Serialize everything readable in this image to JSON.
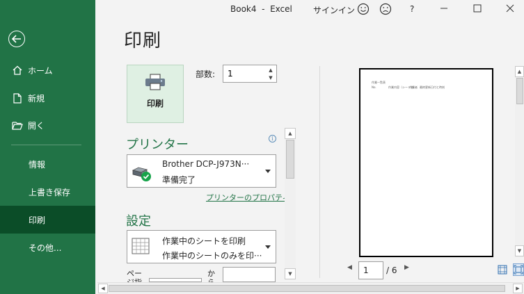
{
  "titlebar": {
    "app_title": "Book4  -  Excel",
    "signin": "サインイン",
    "smile_icon": "smile-icon",
    "frown_icon": "frown-icon",
    "help": "?"
  },
  "sidebar": {
    "back_icon": "back-arrow-icon",
    "items": [
      {
        "label": "ホーム",
        "icon": "home-icon"
      },
      {
        "label": "新規",
        "icon": "new-document-icon"
      },
      {
        "label": "開く",
        "icon": "open-folder-icon"
      },
      {
        "label": "情報"
      },
      {
        "label": "上書き保存"
      },
      {
        "label": "印刷",
        "active": true
      },
      {
        "label": "その他..."
      }
    ]
  },
  "print": {
    "page_title": "印刷",
    "print_button_label": "印刷",
    "copies_label": "部数:",
    "copies_value": "1"
  },
  "printer": {
    "section_title": "プリンター",
    "name": "Brother DCP-J973N···",
    "status": "準備完了",
    "properties_link": "プリンターのプロパティ",
    "info_glyph": "i"
  },
  "settings": {
    "section_title": "設定",
    "scope_line1": "作業中のシートを印刷",
    "scope_line2": "作業中のシートのみを印···",
    "pages_label": "ペー",
    "pages_label_cut": "ジ指",
    "to_label": "か",
    "to_label_cut": "ら"
  },
  "preview": {
    "page_text_1": "作業一覧表",
    "page_text_2": "No.",
    "page_text_3": "作業内容（シート名）",
    "page_text_4": "作業者",
    "page_text_5": "最終更新日付と時刻",
    "current_page": "1",
    "total_pages": "/ 6"
  },
  "colors": {
    "accent": "#217346",
    "accent_dark": "#0b4d28",
    "print_button_bg": "#dff0e3"
  }
}
